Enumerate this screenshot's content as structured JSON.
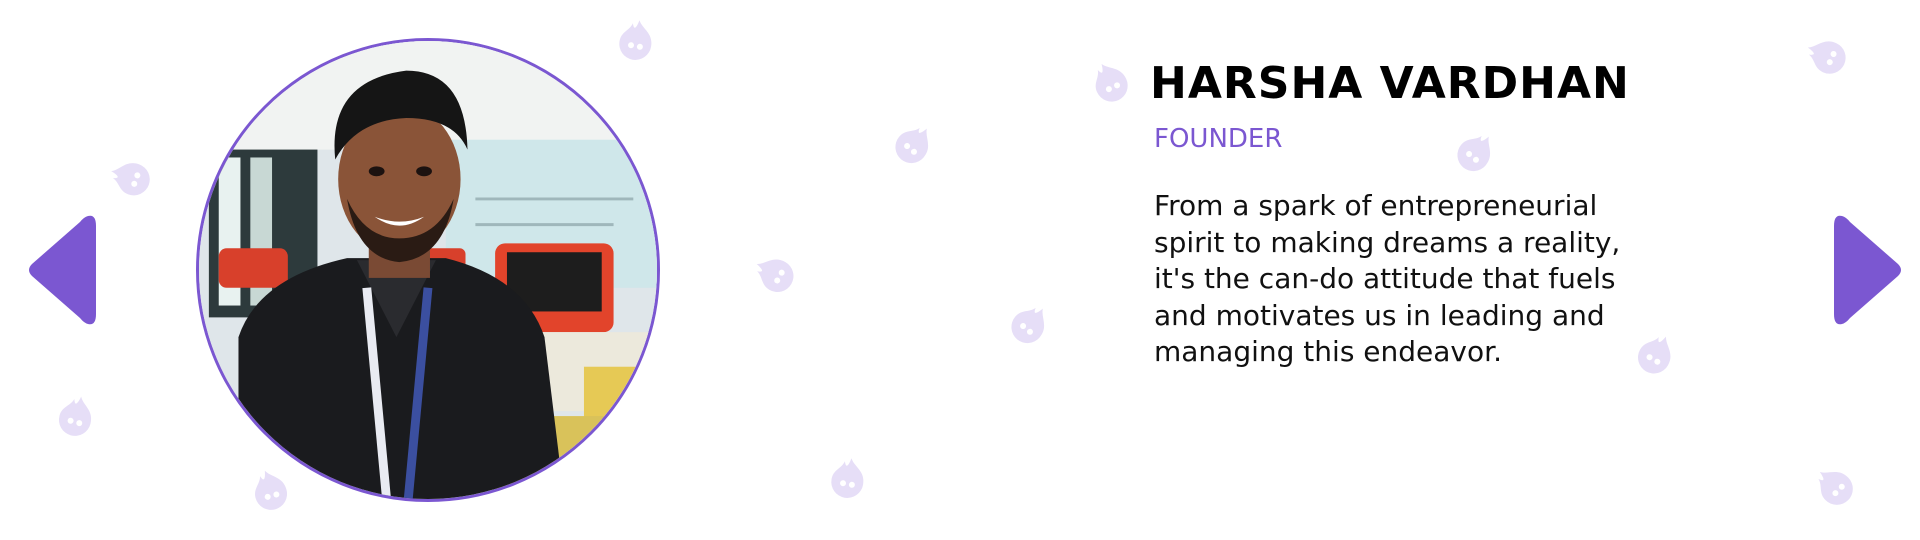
{
  "profile": {
    "name": "HARSHA VARDHAN",
    "role": "FOUNDER",
    "bio_lines": [
      "From a spark of entrepreneurial",
      "spirit to making dreams a reality,",
      "it's the can-do attitude that fuels",
      "and motivates us in leading and",
      "managing this endeavor."
    ],
    "photo": "founder-portrait"
  },
  "carousel": {
    "prev_icon": "arrow-left-icon",
    "next_icon": "arrow-right-icon"
  },
  "decor": {
    "icon": "flame-ghost-icon"
  },
  "colors": {
    "accent": "#7b57d1",
    "decor": "#e6def7",
    "text": "#111111",
    "background": "#ffffff"
  }
}
